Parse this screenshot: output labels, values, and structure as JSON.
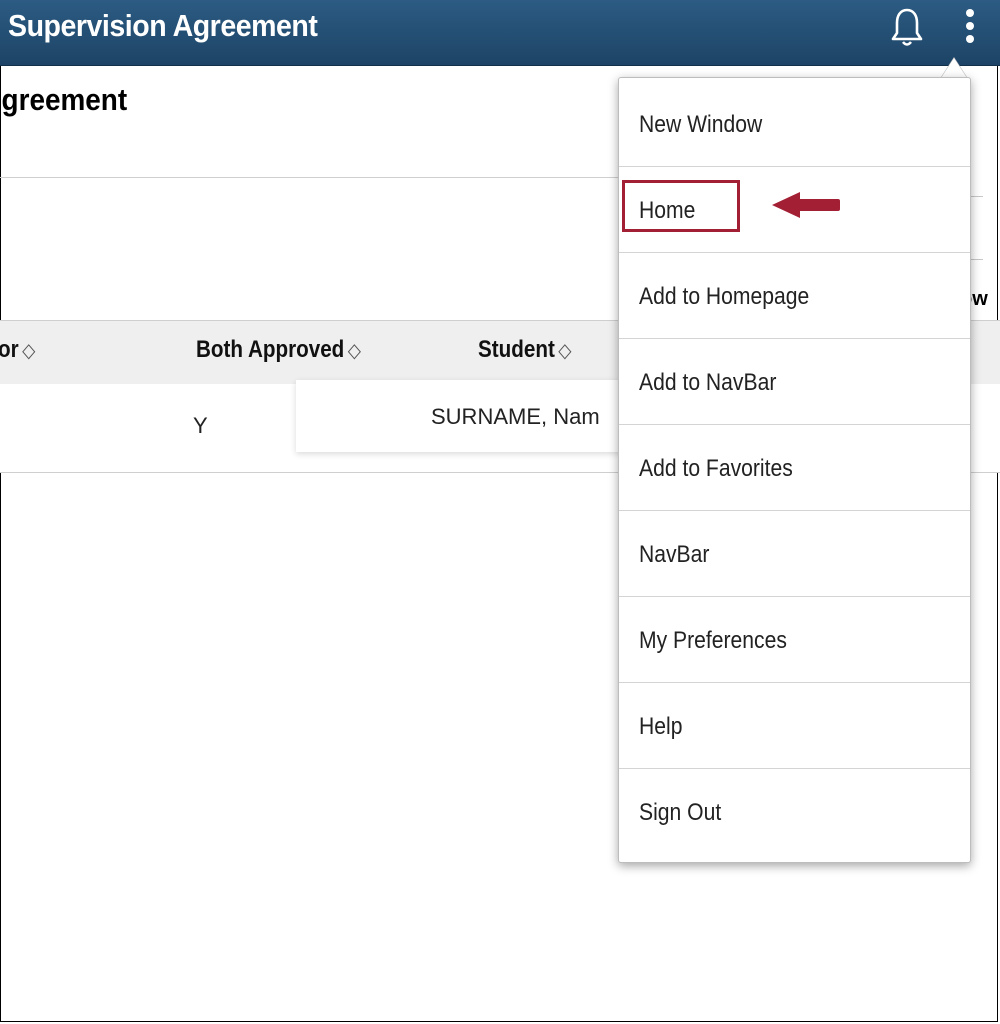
{
  "header": {
    "title": "Supervision Agreement"
  },
  "page": {
    "title": "Supervision Agreement"
  },
  "right_edge_text": "ow",
  "grid": {
    "columns": [
      "or",
      "Both Approved",
      "Student"
    ],
    "rows": [
      {
        "both_approved": "Y",
        "student": "SURNAME, Nam"
      }
    ]
  },
  "menu": {
    "items": [
      "New Window",
      "Home",
      "Add to Homepage",
      "Add to NavBar",
      "Add to Favorites",
      "NavBar",
      "My Preferences",
      "Help",
      "Sign Out"
    ]
  },
  "colors": {
    "header": "#1d4466",
    "highlight": "#a31f34"
  },
  "icons": [
    "bell-icon",
    "kebab-menu-icon",
    "sort-icon",
    "arrow-icon"
  ]
}
